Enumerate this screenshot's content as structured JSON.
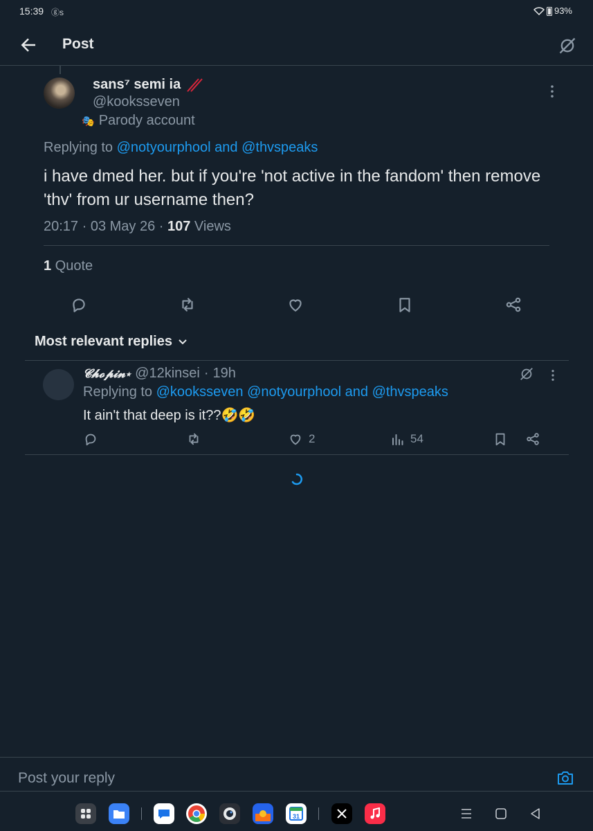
{
  "status": {
    "time": "15:39",
    "notif": "ⓖs",
    "battery": "93%"
  },
  "header": {
    "title": "Post"
  },
  "post": {
    "author_name": "sans⁷ semi ia",
    "handle": "@kooksseven",
    "parody_label": "Parody account",
    "replying_prefix": "Replying to",
    "replying_user1": "@notyourphool",
    "replying_and": "and",
    "replying_user2": "@thvspeaks",
    "body": "i have dmed her. but if you're 'not active in the fandom' then remove 'thv' from ur username then?",
    "time": "20:17 · 03 May 26 · ",
    "views_count": "107",
    "views_label": " Views",
    "quote_count": "1",
    "quote_label": " Quote"
  },
  "replies_sort": {
    "label": "Most relevant replies"
  },
  "reply": {
    "name": "𝓒𝓱𝓸𝓹𝓲𝓷⋆",
    "handle": "@12kinsei",
    "dot": "·",
    "time": "19h",
    "replying_prefix": "Replying to",
    "replying_user1": "@kooksseven",
    "replying_user2": "@notyourphool",
    "replying_and": "and",
    "replying_user3": "@thvspeaks",
    "body": "It ain't that deep is it??🤣🤣",
    "likes": "2",
    "views": "54"
  },
  "composer": {
    "placeholder": "Post your reply"
  },
  "colors": {
    "background": "#15202b",
    "accent": "#1d9bf0",
    "muted": "#8b98a5",
    "divider": "#38444d"
  },
  "icons": {
    "back": "arrow-left-icon",
    "grok": "grok-icon",
    "more": "more-vertical-icon",
    "reply": "reply-icon",
    "repost": "repost-icon",
    "like": "heart-icon",
    "bookmark": "bookmark-icon",
    "share": "share-icon",
    "views": "views-icon",
    "camera": "camera-icon",
    "loading": "spinner-icon"
  }
}
